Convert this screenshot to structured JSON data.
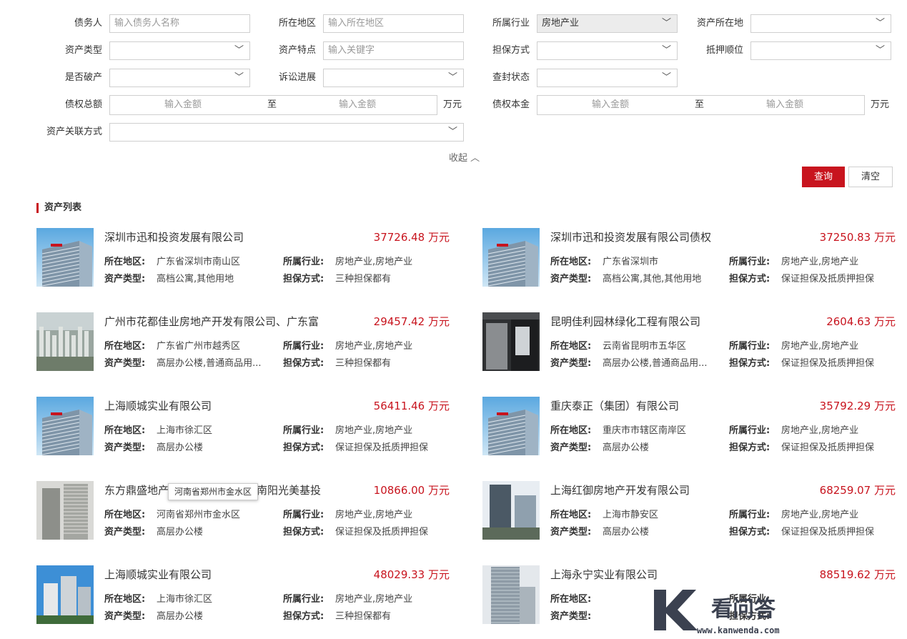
{
  "filters": {
    "debtor": {
      "label": "债务人",
      "placeholder": "输入债务人名称"
    },
    "region": {
      "label": "所在地区",
      "placeholder": "输入所在地区"
    },
    "industry": {
      "label": "所属行业",
      "value": "房地产业"
    },
    "asset_location": {
      "label": "资产所在地",
      "value": ""
    },
    "asset_type": {
      "label": "资产类型",
      "value": ""
    },
    "asset_feature": {
      "label": "资产特点",
      "placeholder": "输入关键字"
    },
    "guarantee": {
      "label": "担保方式",
      "value": ""
    },
    "mortgage_order": {
      "label": "抵押顺位",
      "value": ""
    },
    "bankrupt": {
      "label": "是否破产",
      "value": ""
    },
    "litigation": {
      "label": "诉讼进展",
      "value": ""
    },
    "seizure": {
      "label": "查封状态",
      "value": ""
    },
    "total_claim": {
      "label": "债权总额",
      "from_placeholder": "输入金额",
      "sep": "至",
      "to_placeholder": "输入金额",
      "unit": "万元"
    },
    "principal": {
      "label": "债权本金",
      "from_placeholder": "输入金额",
      "sep": "至",
      "to_placeholder": "输入金额",
      "unit": "万元"
    },
    "relation": {
      "label": "资产关联方式",
      "value": ""
    }
  },
  "collapse_label": "收起 ︿",
  "buttons": {
    "query": "查询",
    "clear": "清空"
  },
  "section_title": "资产列表",
  "field_labels": {
    "region": "所在地区:",
    "industry": "所属行业:",
    "type": "资产类型:",
    "guarantee": "担保方式:"
  },
  "assets": [
    {
      "title": "深圳市迅和投资发展有限公司",
      "price": "37726.48 万元",
      "region": "广东省深圳市南山区",
      "industry": "房地产业,房地产业",
      "type": "高档公寓,其他用地",
      "guarantee": "三种担保都有",
      "thumb": "bank-building"
    },
    {
      "title": "深圳市迅和投资发展有限公司债权",
      "price": "37250.83 万元",
      "region": "广东省深圳市",
      "industry": "房地产业,房地产业",
      "type": "高档公寓,其他,其他用地",
      "guarantee": "保证担保及抵质押担保",
      "thumb": "bank-building"
    },
    {
      "title": "广州市花都佳业房地产开发有限公司、广东富",
      "price": "29457.42 万元",
      "region": "广东省广州市越秀区",
      "industry": "房地产业,房地产业",
      "type": "高层办公楼,普通商品用...",
      "guarantee": "三种担保都有",
      "thumb": "aerial-city"
    },
    {
      "title": "昆明佳利园林绿化工程有限公司",
      "price": "2604.63 万元",
      "region": "云南省昆明市五华区",
      "industry": "房地产业,房地产业",
      "type": "高层办公楼,普通商品用...",
      "guarantee": "保证担保及抵质押担保",
      "thumb": "storefront"
    },
    {
      "title": "上海顺城实业有限公司",
      "price": "56411.46 万元",
      "region": "上海市徐汇区",
      "industry": "房地产业,房地产业",
      "type": "高层办公楼",
      "guarantee": "保证担保及抵质押担保",
      "thumb": "bank-building"
    },
    {
      "title": "重庆泰正（集团）有限公司",
      "price": "35792.29 万元",
      "region": "重庆市市辖区南岸区",
      "industry": "房地产业,房地产业",
      "type": "高层办公楼",
      "guarantee": "保证担保及抵质押担保",
      "thumb": "bank-building"
    },
    {
      "title": "东方鼎盛地产",
      "title_tail": "海南阳光美基投",
      "price": "10866.00 万元",
      "region": "河南省郑州市金水区",
      "industry": "房地产业,房地产业",
      "type": "高层办公楼",
      "guarantee": "保证担保及抵质押担保",
      "thumb": "grey-towers"
    },
    {
      "title": "上海红御房地产开发有限公司",
      "price": "68259.07 万元",
      "region": "上海市静安区",
      "industry": "房地产业,房地产业",
      "type": "高层办公楼",
      "guarantee": "保证担保及抵质押担保",
      "thumb": "street-tower"
    },
    {
      "title": "上海顺城实业有限公司",
      "price": "48029.33 万元",
      "region": "上海市徐汇区",
      "industry": "房地产业,房地产业",
      "type": "高层办公楼",
      "guarantee": "三种担保都有",
      "thumb": "blue-sky-towers"
    },
    {
      "title": "上海永宁实业有限公司",
      "price": "88519.62 万元",
      "region": "",
      "industry": "",
      "type": "",
      "guarantee": "",
      "thumb": "tall-tower"
    }
  ],
  "tooltip": "河南省郑州市金水区",
  "watermark": {
    "text": "看问答",
    "url": "www.kanwenda.com"
  },
  "colors": {
    "accent": "#c8141e"
  }
}
